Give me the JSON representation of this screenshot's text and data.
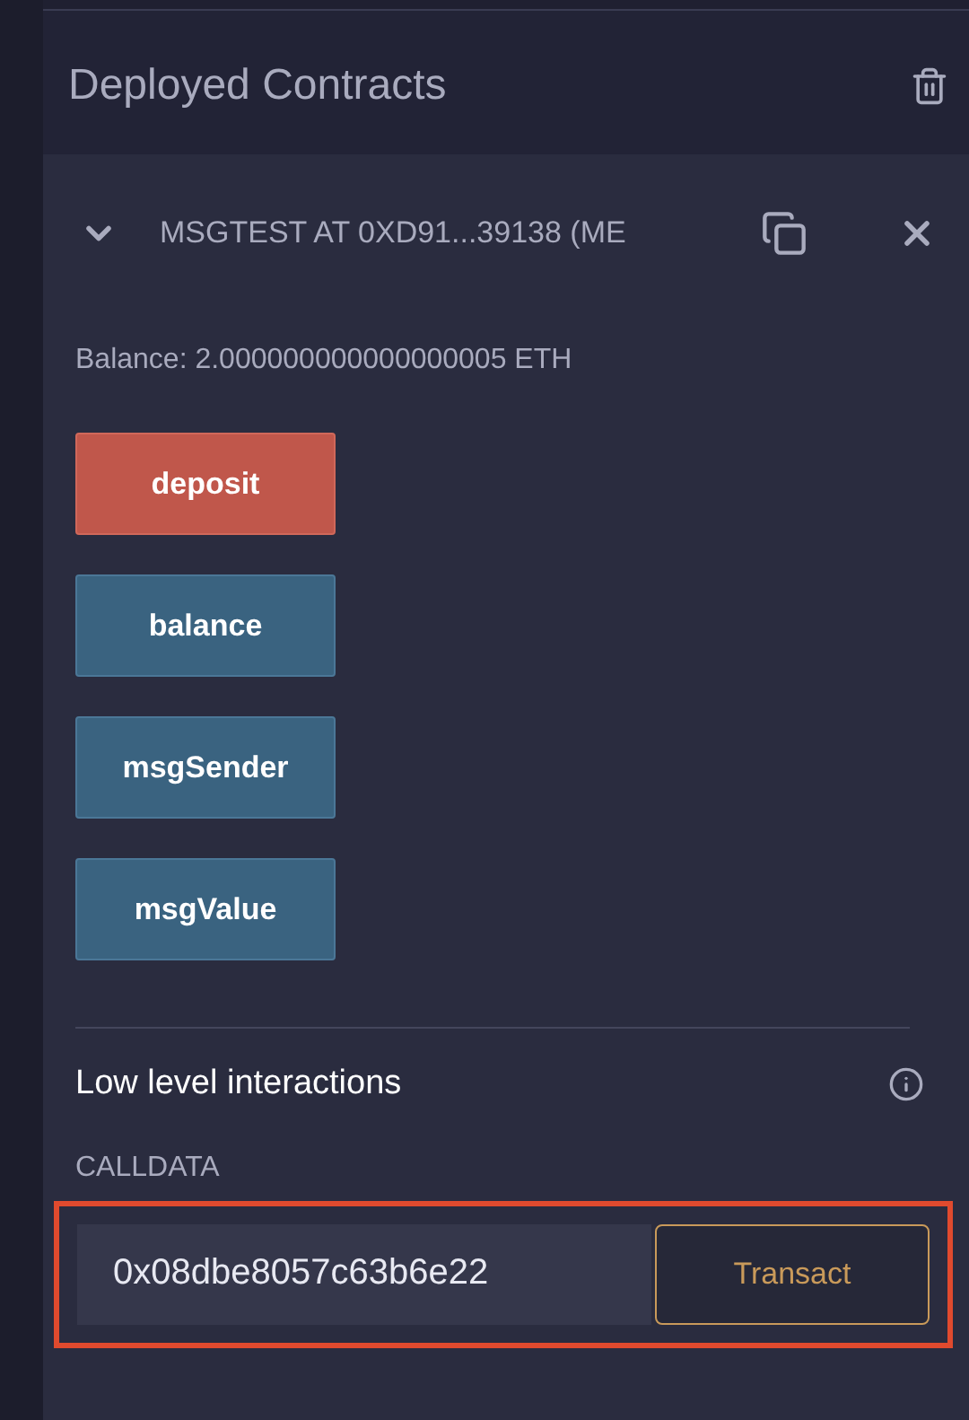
{
  "section": {
    "title": "Deployed Contracts"
  },
  "contract": {
    "expanded": true,
    "title": "MSGTEST AT 0XD91...39138 (ME",
    "balance": "Balance: 2.000000000000000005 ETH",
    "functions": [
      {
        "label": "deposit",
        "kind": "payable"
      },
      {
        "label": "balance",
        "kind": "view"
      },
      {
        "label": "msgSender",
        "kind": "view"
      },
      {
        "label": "msgValue",
        "kind": "view"
      }
    ],
    "low_level": {
      "title": "Low level interactions",
      "calldata_label": "CALLDATA",
      "calldata_value": "0x08dbe8057c63b6e22",
      "button": "Transact",
      "highlighted": true
    }
  }
}
